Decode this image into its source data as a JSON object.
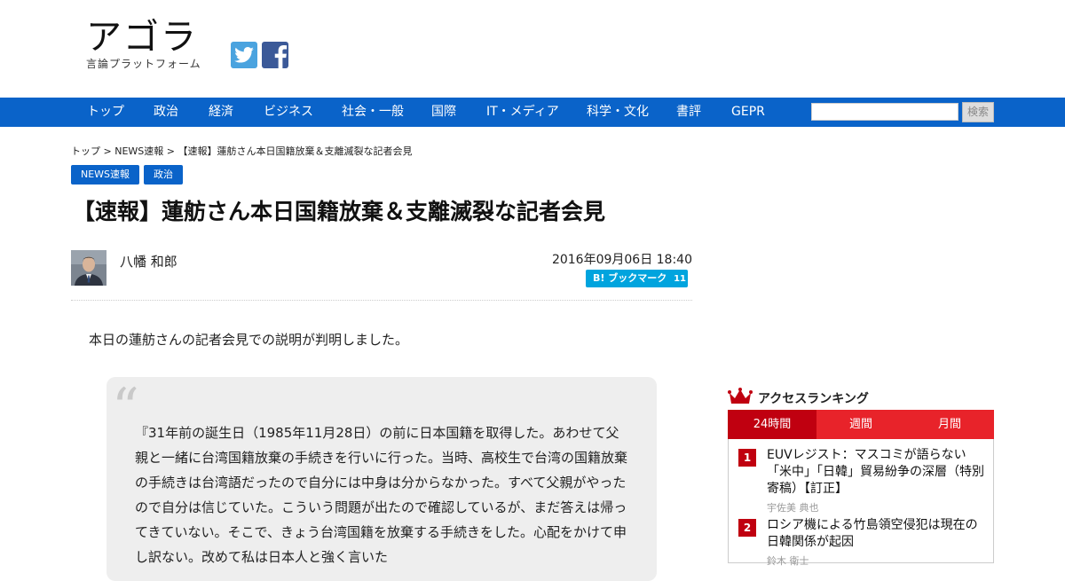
{
  "header": {
    "logo_text": "アゴラ",
    "logo_subtitle": "言論プラットフォーム"
  },
  "nav": {
    "items": [
      "トップ",
      "政治",
      "経済",
      "ビジネス",
      "社会・一般",
      "国際",
      "IT・メディア",
      "科学・文化",
      "書評",
      "GEPR"
    ],
    "search_placeholder": "",
    "search_button": "検索"
  },
  "breadcrumb": "トップ > NEWS速報 > 【速報】蓮舫さん本日国籍放棄＆支離滅裂な記者会見",
  "tags": [
    "NEWS速報",
    "政治"
  ],
  "article": {
    "title": "【速報】蓮舫さん本日国籍放棄＆支離滅裂な記者会見",
    "author": "八幡 和郎",
    "date": "2016年09月06日 18:40",
    "bookmark_label": "B! ブックマーク",
    "bookmark_count": "11",
    "intro": "本日の蓮舫さんの記者会見での説明が判明しました。",
    "quote_mark": "“",
    "quote": "『31年前の誕生日（1985年11月28日）の前に日本国籍を取得した。あわせて父親と一緒に台湾国籍放棄の手続きを行いに行った。当時、高校生で台湾の国籍放棄の手続きは台湾語だったので自分には中身は分からなかった。すべて父親がやったので自分は信じていた。こういう問題が出たので確認しているが、まだ答えは帰ってきていない。そこで、きょう台湾国籍を放棄する手続きをした。心配をかけて申し訳ない。改めて私は日本人と強く言いた"
  },
  "ranking": {
    "title": "アクセスランキング",
    "tabs": [
      "24時間",
      "週間",
      "月間"
    ],
    "active_tab": 0,
    "items": [
      {
        "rank": "1",
        "title": "EUVレジスト：マスコミが語らない「米中」「日韓」貿易紛争の深層（特別寄稿）【訂正】",
        "author": "宇佐美 典也"
      },
      {
        "rank": "2",
        "title": "ロシア機による竹島領空侵犯は現在の日韓関係が起因",
        "author": "鈴木 衛士"
      }
    ]
  },
  "colors": {
    "nav_blue": "#0a63c9",
    "ranking_red": "#e8232a",
    "ranking_dark_red": "#c00010",
    "hatena_blue": "#00a4de"
  }
}
